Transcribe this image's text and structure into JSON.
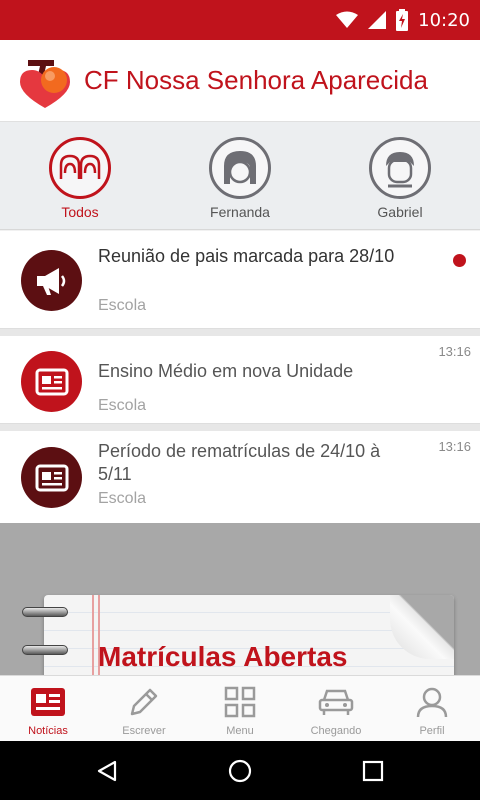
{
  "status_bar": {
    "time": "10:20",
    "icons": [
      "wifi-icon",
      "signal-icon",
      "battery-charging-icon"
    ]
  },
  "header": {
    "title": "CF Nossa Senhora Aparecida",
    "logo_icon": "school-logo-icon"
  },
  "filters": [
    {
      "label": "Todos",
      "icon": "group-icon",
      "active": true
    },
    {
      "label": "Fernanda",
      "icon": "girl-avatar-icon",
      "active": false
    },
    {
      "label": "Gabriel",
      "icon": "boy-avatar-icon",
      "active": false
    }
  ],
  "feed": {
    "items": [
      {
        "title": "Reunião de pais marcada para 28/10",
        "source": "Escola",
        "time": "",
        "unread": true,
        "icon": "megaphone-icon",
        "icon_color": "#5c0f12"
      },
      {
        "title": "Ensino Médio em nova Unidade",
        "source": "Escola",
        "time": "13:16",
        "unread": false,
        "icon": "newspaper-icon",
        "icon_color": "#c0131c"
      },
      {
        "title": "Período de rematrículas de 24/10 à 5/11",
        "source": "Escola",
        "time": "13:16",
        "unread": false,
        "icon": "newspaper-icon",
        "icon_color": "#5c0f12"
      }
    ],
    "banner_text": "Matrículas Abertas"
  },
  "bottom_nav": [
    {
      "label": "Notícias",
      "icon": "news-icon",
      "active": true
    },
    {
      "label": "Escrever",
      "icon": "pencil-icon",
      "active": false
    },
    {
      "label": "Menu",
      "icon": "grid-icon",
      "active": false
    },
    {
      "label": "Chegando",
      "icon": "car-icon",
      "active": false
    },
    {
      "label": "Perfil",
      "icon": "person-icon",
      "active": false
    }
  ],
  "colors": {
    "brand": "#c0131c",
    "brand_dark": "#5c0f12",
    "inactive": "#9a9a9a"
  }
}
